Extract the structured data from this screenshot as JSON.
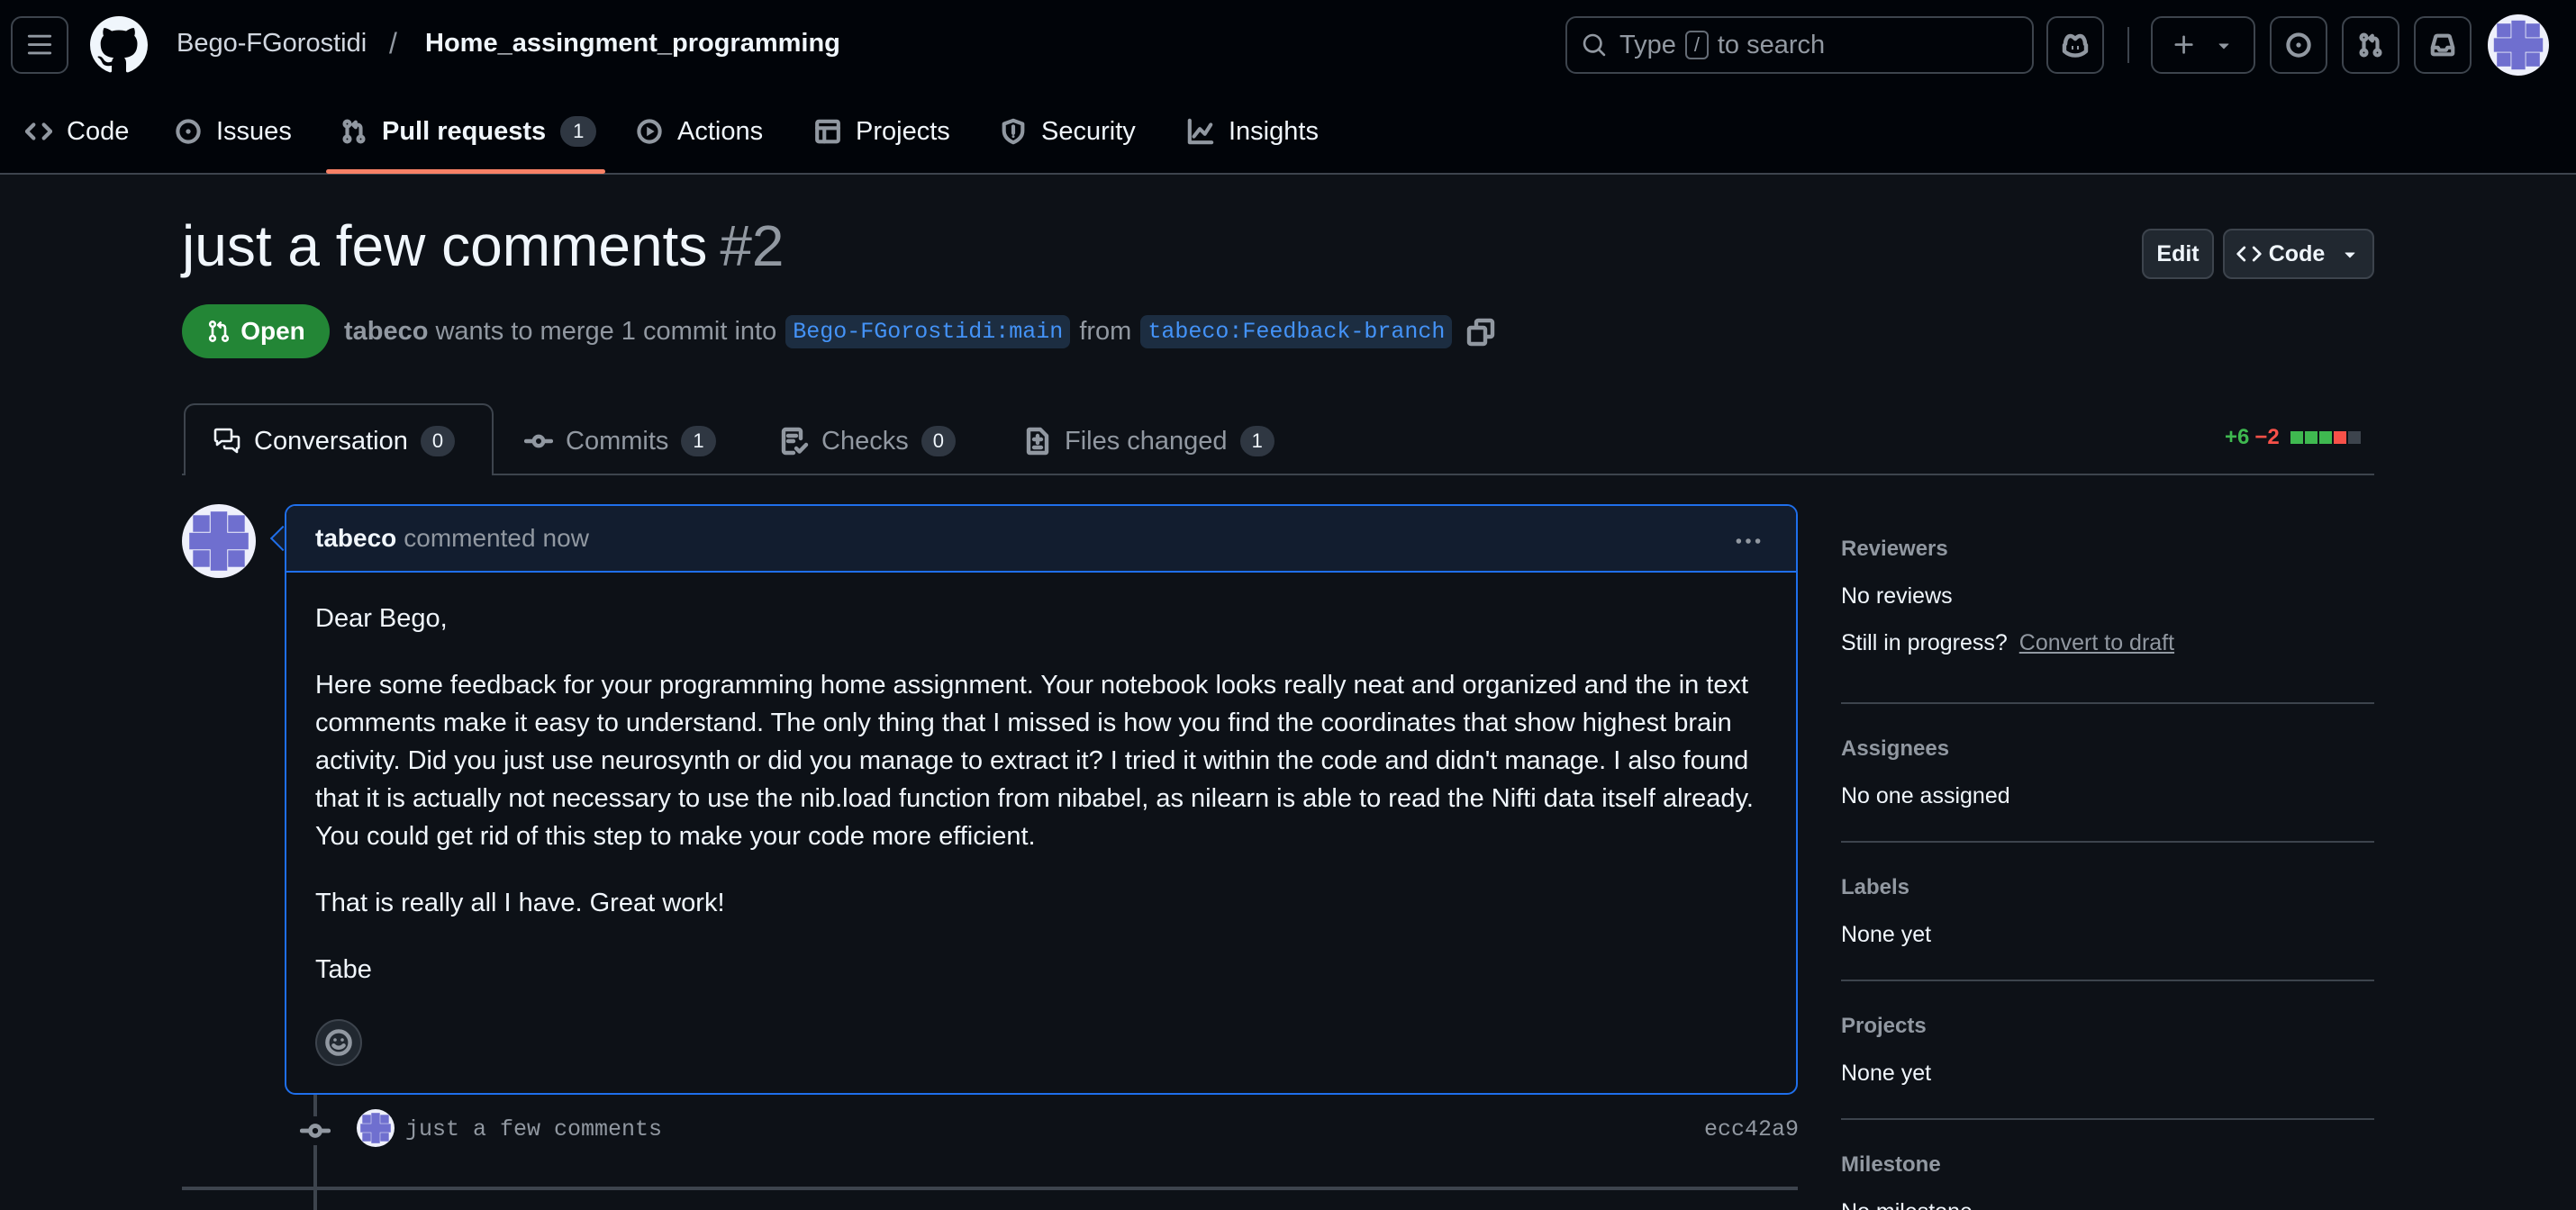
{
  "header": {
    "owner": "Bego-FGorostidi",
    "separator": "/",
    "repo": "Home_assingment_programming",
    "search": {
      "prefix": "Type",
      "key": "/",
      "suffix": "to search"
    }
  },
  "repo_nav": {
    "items": [
      {
        "label": "Code",
        "icon": "code-icon"
      },
      {
        "label": "Issues",
        "icon": "issue-opened-icon"
      },
      {
        "label": "Pull requests",
        "icon": "git-pull-request-icon",
        "count": "1",
        "active": true
      },
      {
        "label": "Actions",
        "icon": "play-icon"
      },
      {
        "label": "Projects",
        "icon": "table-icon"
      },
      {
        "label": "Security",
        "icon": "shield-icon"
      },
      {
        "label": "Insights",
        "icon": "graph-icon"
      }
    ]
  },
  "pr": {
    "title": "just a few comments",
    "number": "#2",
    "status": "Open",
    "author": "tabeco",
    "merge_text": "wants to merge 1 commit into",
    "base_branch": "Bego-FGorostidi:main",
    "from_text": "from",
    "head_branch": "tabeco:Feedback-branch",
    "edit_label": "Edit",
    "code_label": "Code"
  },
  "tabs": [
    {
      "label": "Conversation",
      "count": "0",
      "icon": "comment-discussion-icon",
      "active": true
    },
    {
      "label": "Commits",
      "count": "1",
      "icon": "git-commit-icon"
    },
    {
      "label": "Checks",
      "count": "0",
      "icon": "checklist-icon"
    },
    {
      "label": "Files changed",
      "count": "1",
      "icon": "file-diff-icon"
    }
  ],
  "diffstat": {
    "additions": "+6",
    "deletions": "−2",
    "blocks": [
      "green",
      "green",
      "green",
      "red",
      "gray"
    ],
    "colors": {
      "green": "#3fb950",
      "red": "#f85149",
      "gray": "#3d444d"
    }
  },
  "comment": {
    "author": "tabeco",
    "action": "commented",
    "time": "now",
    "paragraphs": [
      "Dear Bego,",
      "Here some feedback for your programming home assignment. Your notebook looks really neat and organized and the in text comments make it easy to understand. The only thing that I missed is how you find the coordinates that show highest brain activity. Did you just use neurosynth or did you manage to extract it? I tried it within the code and didn't manage. I also found that it is actually not necessary to use the nib.load function from nibabel, as nilearn is able to read the Nifti data itself already. You could get rid of this step to make your code more efficient.",
      "That is really all I have. Great work!",
      "Tabe"
    ]
  },
  "commit": {
    "message": "just a few comments",
    "sha": "ecc42a9"
  },
  "sidebar": {
    "reviewers": {
      "heading": "Reviewers",
      "value": "No reviews",
      "draft_prompt": "Still in progress?",
      "draft_link": "Convert to draft"
    },
    "assignees": {
      "heading": "Assignees",
      "value": "No one assigned"
    },
    "labels": {
      "heading": "Labels",
      "value": "None yet"
    },
    "projects": {
      "heading": "Projects",
      "value": "None yet"
    },
    "milestone": {
      "heading": "Milestone",
      "value": "No milestone"
    }
  },
  "colors": {
    "accent_underline": "#f78166",
    "open_badge": "#238636",
    "link": "#4493f8",
    "comment_border": "#1f6feb"
  }
}
